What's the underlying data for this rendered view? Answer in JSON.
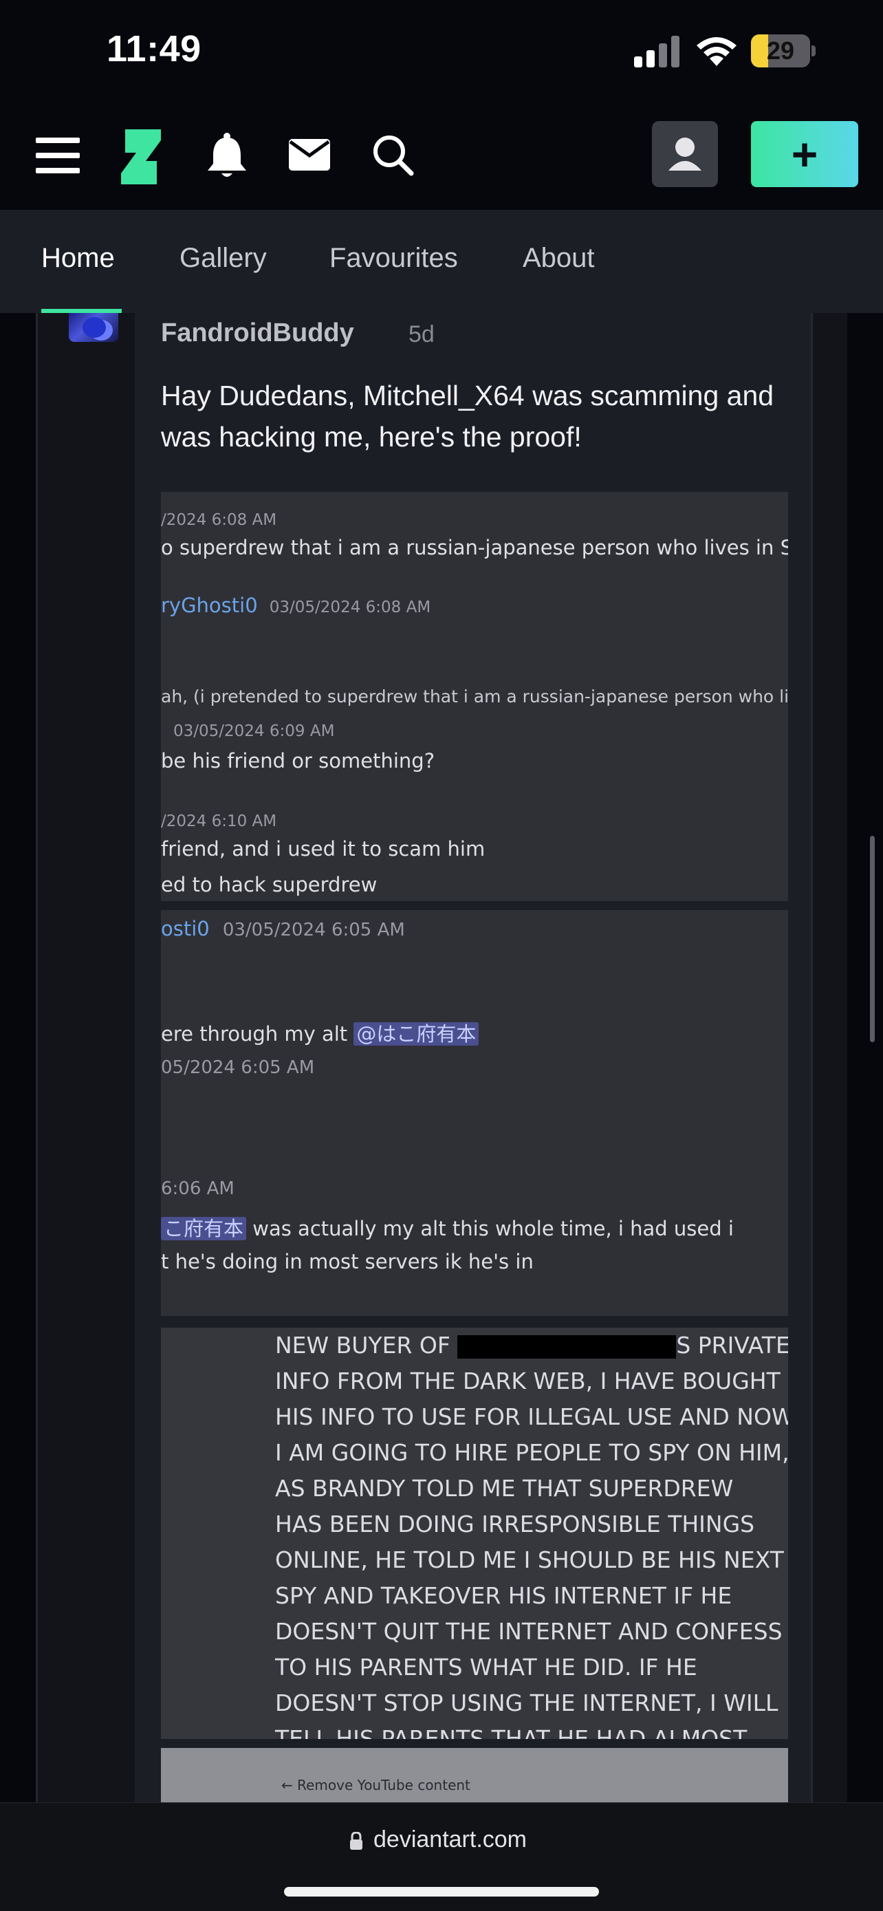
{
  "status_bar": {
    "time": "11:49",
    "battery": "29",
    "battery_level": 0.29,
    "icons": [
      "cellular-signal-icon",
      "wifi-icon",
      "battery-icon"
    ]
  },
  "header": {
    "icons": [
      "menu-icon",
      "deviantart-logo-icon",
      "bell-icon",
      "mail-icon",
      "search-icon",
      "avatar-icon"
    ],
    "create_label": "+",
    "accent_color": "#3ee49f"
  },
  "tabs": [
    {
      "label": "Home",
      "active": true
    },
    {
      "label": "Gallery",
      "active": false
    },
    {
      "label": "Favourites",
      "active": false
    },
    {
      "label": "About",
      "active": false
    }
  ],
  "comment": {
    "username": "FandroidBuddy",
    "time_ago": "5d",
    "text": "Hay Dudedans, Mitchell_X64 was scamming and was hacking me, here's the proof!",
    "screenshot1": {
      "l1": "/2024 6:08 AM",
      "l2": "o superdrew that i am a russian-japanese person who lives in Sakha",
      "l3_user": "ryGhosti0",
      "l3_time": "03/05/2024 6:08 AM",
      "l4": "ah, (i pretended to superdrew that i am a russian-japanese person who lives in",
      "l5": "03/05/2024 6:09 AM",
      "l6": "be his friend or something?",
      "l7": "/2024 6:10 AM",
      "l8": "friend, and i used it to scam him",
      "l9": "ed to hack superdrew"
    },
    "screenshot2": {
      "l1_user": "osti0",
      "l1_time": "03/05/2024 6:05 AM",
      "l2_text": "ere through my alt ",
      "l2_mention": "@はこ府有本",
      "l3": "05/2024 6:05 AM",
      "l4": "6:06 AM",
      "l5_mention": "こ府有本",
      "l5_text": " was actually my alt this whole time, i had used i",
      "l6": "t he's doing in most servers ik he's in"
    },
    "screenshot3": {
      "lines": [
        "INFO FROM THE DARK WEB, I HAVE BOUGHT",
        "HIS INFO TO USE FOR ILLEGAL USE AND NOW",
        "I AM GOING TO HIRE PEOPLE TO SPY ON HIM,",
        "AS BRANDY TOLD ME THAT SUPERDREW",
        "HAS BEEN DOING IRRESPONSIBLE THINGS",
        "ONLINE, HE TOLD ME I SHOULD BE HIS NEXT",
        "SPY AND TAKEOVER HIS INTERNET IF HE",
        "DOESN'T QUIT THE INTERNET AND CONFESS",
        "TO HIS PARENTS WHAT HE DID. IF HE",
        "DOESN'T STOP USING THE INTERNET, I WILL",
        "TELL HIS PARENTS THAT HE HAD ALMOST"
      ],
      "first_a": "NEW BUYER OF ",
      "first_b": "S PRIVATE"
    },
    "screenshot4": {
      "text": "←  Remove YouTube content"
    }
  },
  "browser": {
    "domain": "deviantart.com"
  }
}
